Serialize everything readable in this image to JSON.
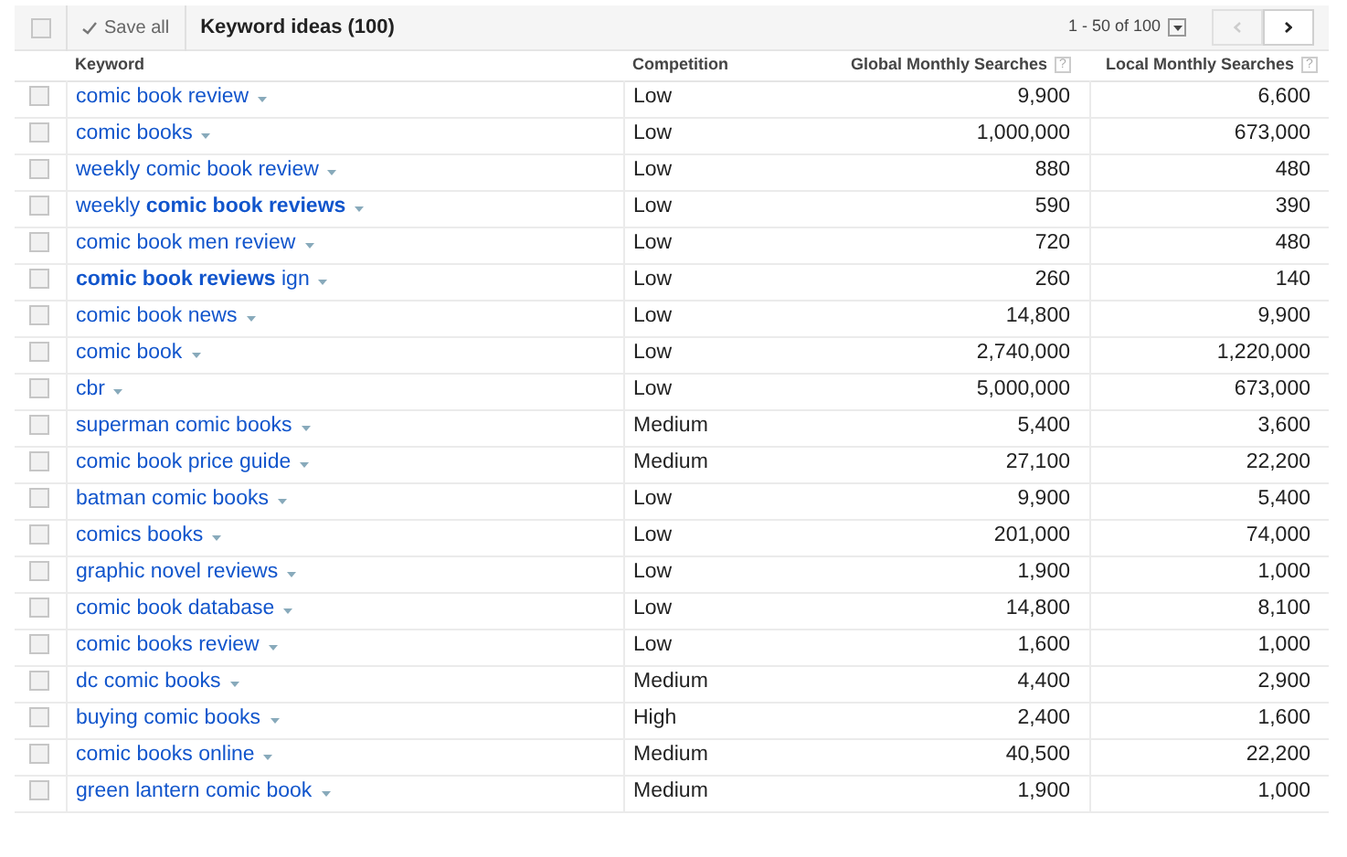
{
  "toolbar": {
    "select_all_checked": false,
    "save_all": "Save all",
    "title": "Keyword ideas (100)",
    "pagination": "1 - 50 of 100"
  },
  "columns": [
    "Keyword",
    "Competition",
    "Global Monthly Searches",
    "Local Monthly Searches"
  ],
  "column_help": [
    "?",
    "?"
  ],
  "rows": [
    {
      "keyword": "comic book review",
      "competition": "Low",
      "global": "9,900",
      "local": "6,600",
      "checked": false
    },
    {
      "keyword": "comic books",
      "competition": "Low",
      "global": "1,000,000",
      "local": "673,000",
      "checked": false
    },
    {
      "keyword": "weekly comic book review",
      "competition": "Low",
      "global": "880",
      "local": "480",
      "checked": false
    },
    {
      "keyword": "weekly **comic book reviews**",
      "competition": "Low",
      "global": "590",
      "local": "390",
      "checked": false
    },
    {
      "keyword": "comic book men review",
      "competition": "Low",
      "global": "720",
      "local": "480",
      "checked": false
    },
    {
      "keyword": "**comic book reviews** ign",
      "competition": "Low",
      "global": "260",
      "local": "140",
      "checked": false
    },
    {
      "keyword": "comic book news",
      "competition": "Low",
      "global": "14,800",
      "local": "9,900",
      "checked": false
    },
    {
      "keyword": "comic book",
      "competition": "Low",
      "global": "2,740,000",
      "local": "1,220,000",
      "checked": false
    },
    {
      "keyword": "cbr",
      "competition": "Low",
      "global": "5,000,000",
      "local": "673,000",
      "checked": false
    },
    {
      "keyword": "superman comic books",
      "competition": "Medium",
      "global": "5,400",
      "local": "3,600",
      "checked": false
    },
    {
      "keyword": "comic book price guide",
      "competition": "Medium",
      "global": "27,100",
      "local": "22,200",
      "checked": false
    },
    {
      "keyword": "batman comic books",
      "competition": "Low",
      "global": "9,900",
      "local": "5,400",
      "checked": false
    },
    {
      "keyword": "comics books",
      "competition": "Low",
      "global": "201,000",
      "local": "74,000",
      "checked": false
    },
    {
      "keyword": "graphic novel reviews",
      "competition": "Low",
      "global": "1,900",
      "local": "1,000",
      "checked": false
    },
    {
      "keyword": "comic book database",
      "competition": "Low",
      "global": "14,800",
      "local": "8,100",
      "checked": false
    },
    {
      "keyword": "comic books review",
      "competition": "Low",
      "global": "1,600",
      "local": "1,000",
      "checked": false
    },
    {
      "keyword": "dc comic books",
      "competition": "Medium",
      "global": "4,400",
      "local": "2,900",
      "checked": false
    },
    {
      "keyword": "buying comic books",
      "competition": "High",
      "global": "2,400",
      "local": "1,600",
      "checked": false
    },
    {
      "keyword": "comic books online",
      "competition": "Medium",
      "global": "40,500",
      "local": "22,200",
      "checked": false
    },
    {
      "keyword": "green lantern comic book",
      "competition": "Medium",
      "global": "1,900",
      "local": "1,000",
      "checked": false
    }
  ]
}
